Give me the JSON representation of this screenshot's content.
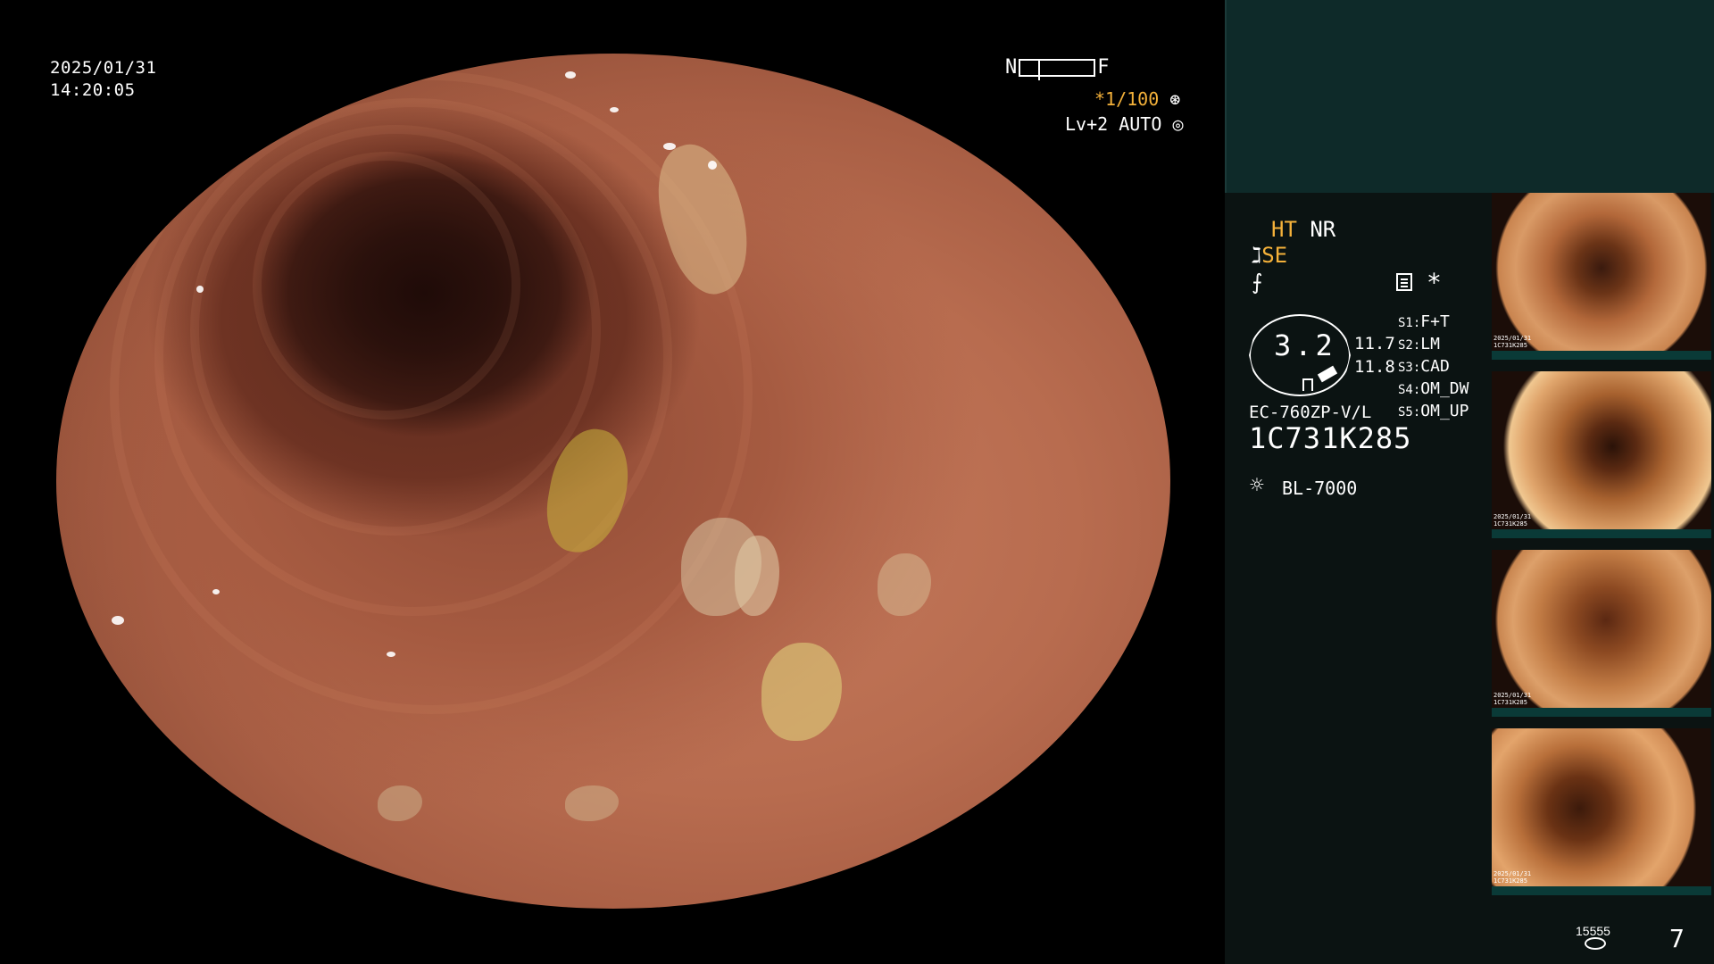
{
  "overlay": {
    "date": "2025/01/31",
    "time": "14:20:05",
    "near_label": "N",
    "far_label": "F",
    "shutter": "*1/100",
    "level": "Lv+2",
    "mode": "AUTO"
  },
  "panel": {
    "ht": "HT",
    "nr": "NR",
    "se": "SE",
    "f_symbol": "⨍",
    "asterisk": "*",
    "gauge_value": "3.2",
    "value_1": "11.7",
    "value_2": "11.8",
    "settings": [
      {
        "key": "S1:",
        "value": "F+T"
      },
      {
        "key": "S2:",
        "value": "LM"
      },
      {
        "key": "S3:",
        "value": "CAD"
      },
      {
        "key": "S4:",
        "value": "OM_DW"
      },
      {
        "key": "S5:",
        "value": "OM_UP"
      }
    ],
    "scope_model": "EC-760ZP-V/L",
    "scope_serial": "1C731K285",
    "light_source": "BL-7000",
    "image_count_small": "15555",
    "image_count": "7"
  },
  "thumbnails": [
    {
      "label_line1": "2025/01/31",
      "label_line2": "1C731K285"
    },
    {
      "label_line1": "2025/01/31",
      "label_line2": "1C731K285"
    },
    {
      "label_line1": "2025/01/31",
      "label_line2": "1C731K285"
    },
    {
      "label_line1": "2025/01/31",
      "label_line2": "1C731K285"
    }
  ],
  "colors": {
    "accent": "#f4b13a",
    "panel_bg": "#0b1312",
    "panel_header_bg": "#0e2a29",
    "thumb_bar": "#0a3a37"
  },
  "icons": {
    "se": "se-icon",
    "light": "light-source-icon",
    "menu": "menu-icon",
    "db": "storage-icon"
  }
}
